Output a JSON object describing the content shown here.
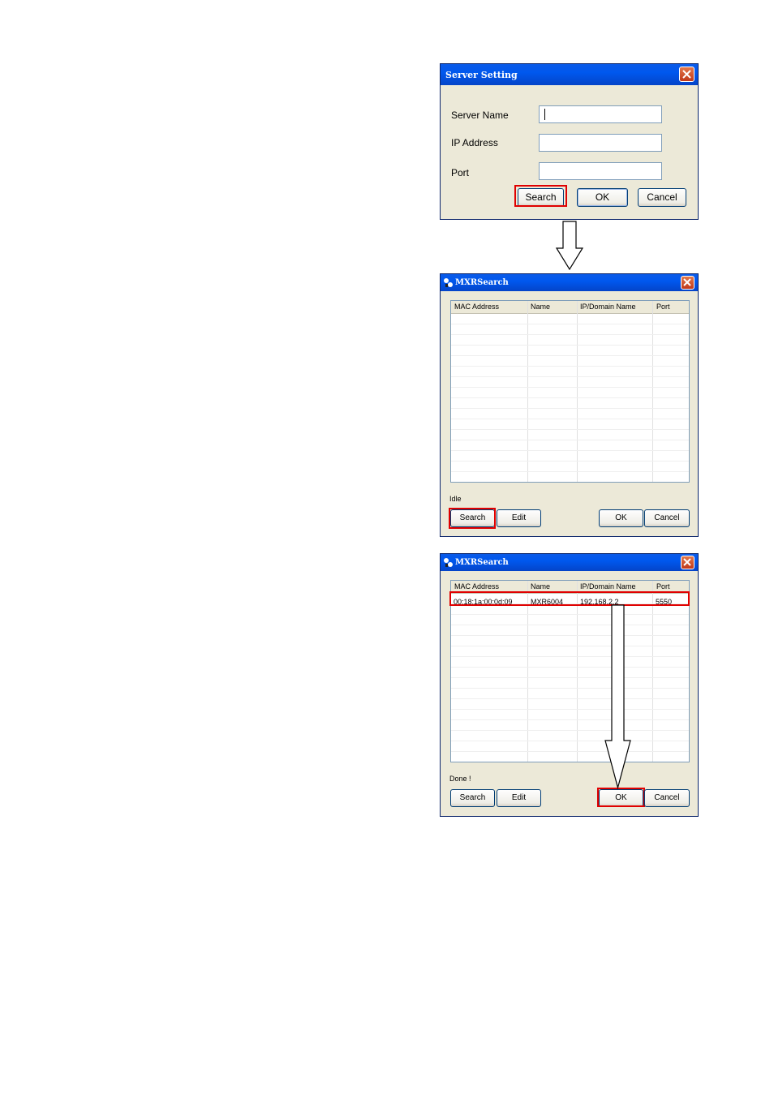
{
  "server_setting": {
    "title": "Server Setting",
    "labels": {
      "server_name": "Server Name",
      "ip_address": "IP Address",
      "port": "Port"
    },
    "values": {
      "server_name": "",
      "ip_address": "",
      "port": ""
    },
    "buttons": {
      "search": "Search",
      "ok": "OK",
      "cancel": "Cancel"
    }
  },
  "mxr_idle": {
    "title": "MXRSearch",
    "columns": [
      "MAC Address",
      "Name",
      "IP/Domain Name",
      "Port"
    ],
    "status": "Idle",
    "buttons": {
      "search": "Search",
      "edit": "Edit",
      "ok": "OK",
      "cancel": "Cancel"
    }
  },
  "mxr_done": {
    "title": "MXRSearch",
    "columns": [
      "MAC Address",
      "Name",
      "IP/Domain Name",
      "Port"
    ],
    "rows": [
      {
        "mac": "00:18:1a:00:0d:09",
        "name": "MXR6004",
        "ip": "192.168.2.2",
        "port": "5550"
      }
    ],
    "status": "Done !",
    "buttons": {
      "search": "Search",
      "edit": "Edit",
      "ok": "OK",
      "cancel": "Cancel"
    }
  }
}
